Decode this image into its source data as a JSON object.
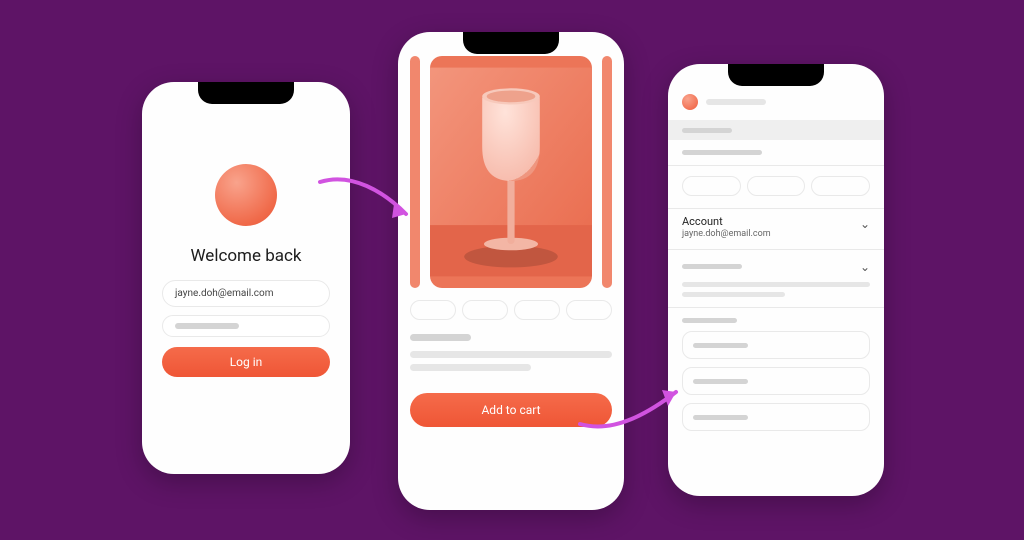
{
  "colors": {
    "accent": "#f05a3a",
    "background": "#5e1466",
    "arrow": "#d153e0"
  },
  "login": {
    "title": "Welcome back",
    "email_value": "jayne.doh@email.com",
    "password_value": "",
    "button_label": "Log in"
  },
  "product": {
    "image_subject": "goblet",
    "cta_label": "Add to cart"
  },
  "settings": {
    "account_label": "Account",
    "account_email": "jayne.doh@email.com"
  }
}
